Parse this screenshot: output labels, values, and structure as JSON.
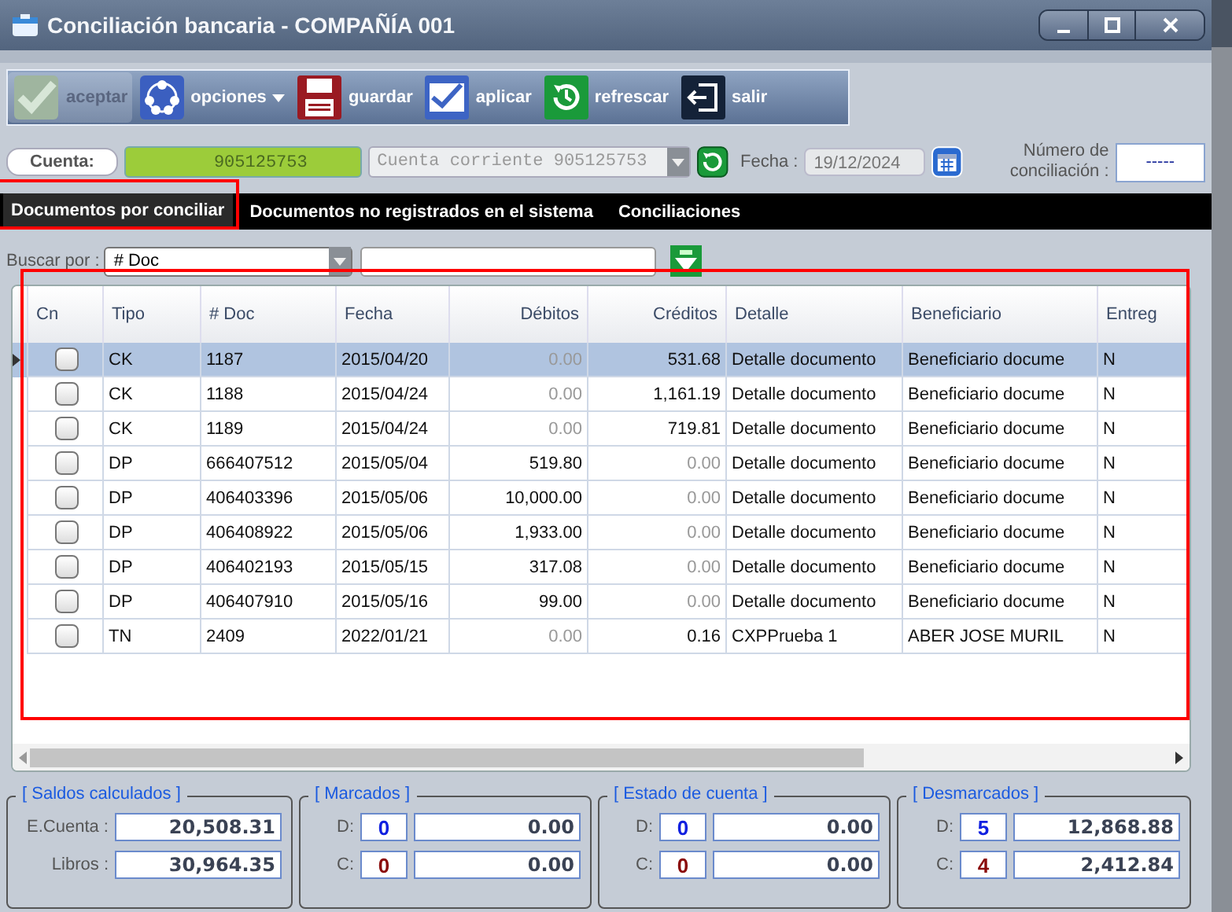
{
  "window": {
    "title": "Conciliación bancaria - COMPAÑÍA 001"
  },
  "toolbar": [
    {
      "kind": "accept",
      "label": "aceptar",
      "disabled": true,
      "caret": false
    },
    {
      "kind": "options",
      "label": "opciones",
      "disabled": false,
      "caret": true
    },
    {
      "kind": "save",
      "label": "guardar",
      "disabled": false,
      "caret": false
    },
    {
      "kind": "apply",
      "label": "aplicar",
      "disabled": false,
      "caret": false
    },
    {
      "kind": "refresh",
      "label": "refrescar",
      "disabled": false,
      "caret": false
    },
    {
      "kind": "exit",
      "label": "salir",
      "disabled": false,
      "caret": false
    }
  ],
  "account": {
    "label": "Cuenta:",
    "value": "905125753",
    "type": "Cuenta corriente 905125753",
    "date_label": "Fecha :",
    "date": "19/12/2024",
    "number_label": "Número de conciliación :",
    "number": "-----"
  },
  "tabs": [
    {
      "label": "Documentos por conciliar",
      "selected": true
    },
    {
      "label": "Documentos no registrados en el sistema",
      "selected": false
    },
    {
      "label": "Conciliaciones",
      "selected": false
    }
  ],
  "search": {
    "label": "Buscar por :",
    "field": "# Doc"
  },
  "table": {
    "columns": [
      "Cn",
      "Tipo",
      "# Doc",
      "Fecha",
      "Débitos",
      "Créditos",
      "Detalle",
      "Beneficiario",
      "Entreg"
    ],
    "rows": [
      {
        "selected": true,
        "checked": false,
        "tipo": "CK",
        "doc": "1187",
        "fecha": "2015/04/20",
        "debit": {
          "text": "0.00",
          "muted": true
        },
        "credit": {
          "text": "531.68",
          "muted": false
        },
        "detalle": "Detalle documento",
        "beneficiario": "Beneficiario docume",
        "entreg": "N"
      },
      {
        "selected": false,
        "checked": false,
        "tipo": "CK",
        "doc": "1188",
        "fecha": "2015/04/24",
        "debit": {
          "text": "0.00",
          "muted": true
        },
        "credit": {
          "text": "1,161.19",
          "muted": false
        },
        "detalle": "Detalle documento",
        "beneficiario": "Beneficiario docume",
        "entreg": "N"
      },
      {
        "selected": false,
        "checked": false,
        "tipo": "CK",
        "doc": "1189",
        "fecha": "2015/04/24",
        "debit": {
          "text": "0.00",
          "muted": true
        },
        "credit": {
          "text": "719.81",
          "muted": false
        },
        "detalle": "Detalle documento",
        "beneficiario": "Beneficiario docume",
        "entreg": "N"
      },
      {
        "selected": false,
        "checked": false,
        "tipo": "DP",
        "doc": "666407512",
        "fecha": "2015/05/04",
        "debit": {
          "text": "519.80",
          "muted": false
        },
        "credit": {
          "text": "0.00",
          "muted": true
        },
        "detalle": "Detalle documento",
        "beneficiario": "Beneficiario docume",
        "entreg": "N"
      },
      {
        "selected": false,
        "checked": false,
        "tipo": "DP",
        "doc": "406403396",
        "fecha": "2015/05/06",
        "debit": {
          "text": "10,000.00",
          "muted": false
        },
        "credit": {
          "text": "0.00",
          "muted": true
        },
        "detalle": "Detalle documento",
        "beneficiario": "Beneficiario docume",
        "entreg": "N"
      },
      {
        "selected": false,
        "checked": false,
        "tipo": "DP",
        "doc": "406408922",
        "fecha": "2015/05/06",
        "debit": {
          "text": "1,933.00",
          "muted": false
        },
        "credit": {
          "text": "0.00",
          "muted": true
        },
        "detalle": "Detalle documento",
        "beneficiario": "Beneficiario docume",
        "entreg": "N"
      },
      {
        "selected": false,
        "checked": false,
        "tipo": "DP",
        "doc": "406402193",
        "fecha": "2015/05/15",
        "debit": {
          "text": "317.08",
          "muted": false
        },
        "credit": {
          "text": "0.00",
          "muted": true
        },
        "detalle": "Detalle documento",
        "beneficiario": "Beneficiario docume",
        "entreg": "N"
      },
      {
        "selected": false,
        "checked": false,
        "tipo": "DP",
        "doc": "406407910",
        "fecha": "2015/05/16",
        "debit": {
          "text": "99.00",
          "muted": false
        },
        "credit": {
          "text": "0.00",
          "muted": true
        },
        "detalle": "Detalle documento",
        "beneficiario": "Beneficiario docume",
        "entreg": "N"
      },
      {
        "selected": false,
        "checked": false,
        "tipo": "TN",
        "doc": "2409",
        "fecha": "2022/01/21",
        "debit": {
          "text": "0.00",
          "muted": true
        },
        "credit": {
          "text": "0.16",
          "muted": false
        },
        "detalle": "CXPPrueba 1",
        "beneficiario": "ABER JOSE MURIL",
        "entreg": "N"
      }
    ]
  },
  "summary": [
    {
      "kind": "balances",
      "title": "[ Saldos calculados ]",
      "rows": [
        {
          "label": "E.Cuenta :",
          "amount": "20,508.31"
        },
        {
          "label": "Libros :",
          "amount": "30,964.35"
        }
      ]
    },
    {
      "kind": "counts",
      "title": "[ Marcados ]",
      "rows": [
        {
          "kind": "debit",
          "label": "D:",
          "count": "0",
          "amount": "0.00"
        },
        {
          "kind": "credit",
          "label": "C:",
          "count": "0",
          "amount": "0.00"
        }
      ]
    },
    {
      "kind": "counts",
      "title": "[ Estado de cuenta ]",
      "rows": [
        {
          "kind": "debit",
          "label": "D:",
          "count": "0",
          "amount": "0.00"
        },
        {
          "kind": "credit",
          "label": "C:",
          "count": "0",
          "amount": "0.00"
        }
      ]
    },
    {
      "kind": "counts",
      "title": "[ Desmarcados ]",
      "rows": [
        {
          "kind": "debit",
          "label": "D:",
          "count": "5",
          "amount": "12,868.88"
        },
        {
          "kind": "credit",
          "label": "C:",
          "count": "4",
          "amount": "2,412.84"
        }
      ]
    }
  ]
}
